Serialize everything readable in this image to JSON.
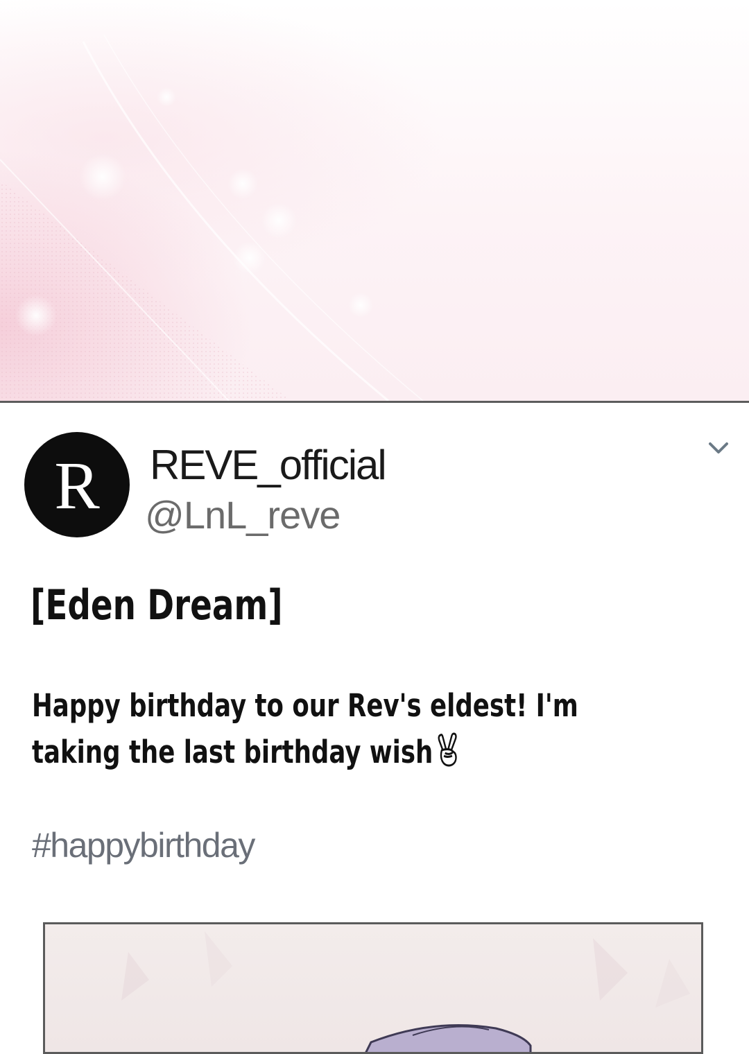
{
  "tweet": {
    "avatar_letter": "R",
    "display_name": "REVE_official",
    "handle": "@LnL_reve",
    "title": "[Eden Dream]",
    "body_lines": [
      "Happy birthday to our Rev's eldest! I'm",
      "taking the last birthday wish"
    ],
    "emoji": "victory-hand-icon",
    "hashtag": "#happybirthday"
  },
  "colors": {
    "avatar_bg": "#0d0d0d",
    "hashtag": "#6a6f78",
    "handle": "#6b6b6b",
    "panel_pink": "#f3c4d2"
  }
}
